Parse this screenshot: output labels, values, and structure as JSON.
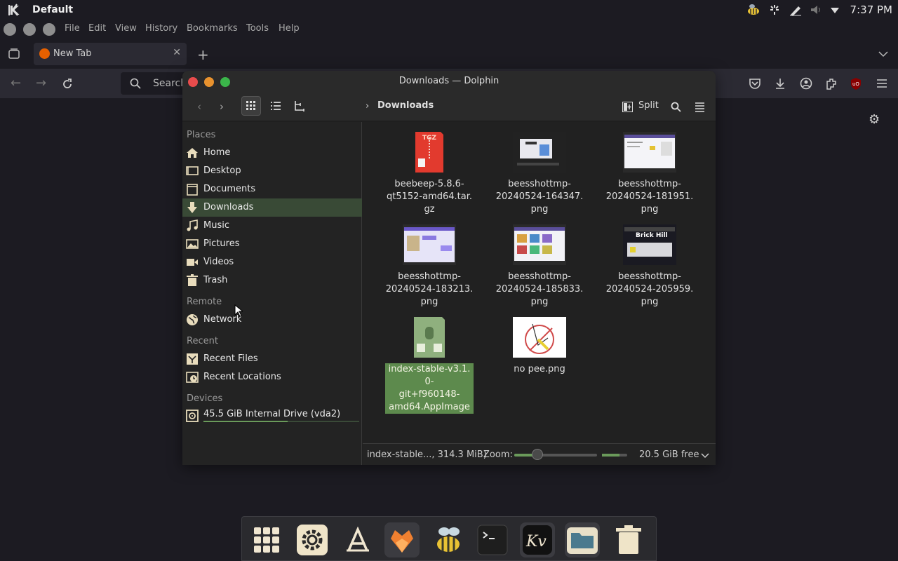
{
  "system": {
    "workspace_title": "Default",
    "clock": "7:37 PM"
  },
  "browser": {
    "menu": [
      "File",
      "Edit",
      "View",
      "History",
      "Bookmarks",
      "Tools",
      "Help"
    ],
    "tab": {
      "label": "New Tab"
    },
    "url_placeholder": "Search"
  },
  "dolphin": {
    "window_title": "Downloads — Dolphin",
    "breadcrumb": "Downloads",
    "split_label": "Split",
    "sidebar": {
      "places_header": "Places",
      "places": [
        {
          "label": "Home",
          "icon": "home-icon"
        },
        {
          "label": "Desktop",
          "icon": "desktop-icon"
        },
        {
          "label": "Documents",
          "icon": "documents-icon"
        },
        {
          "label": "Downloads",
          "icon": "downloads-icon",
          "selected": true
        },
        {
          "label": "Music",
          "icon": "music-icon"
        },
        {
          "label": "Pictures",
          "icon": "pictures-icon"
        },
        {
          "label": "Videos",
          "icon": "videos-icon"
        },
        {
          "label": "Trash",
          "icon": "trash-icon"
        }
      ],
      "remote_header": "Remote",
      "remote": [
        {
          "label": "Network",
          "icon": "network-icon"
        }
      ],
      "recent_header": "Recent",
      "recent": [
        {
          "label": "Recent Files",
          "icon": "recent-files-icon"
        },
        {
          "label": "Recent Locations",
          "icon": "recent-locations-icon"
        }
      ],
      "devices_header": "Devices",
      "devices": [
        {
          "label": "45.5 GiB Internal Drive (vda2)",
          "icon": "drive-icon",
          "usage_fraction": 0.54
        }
      ]
    },
    "files": [
      {
        "name": "beebeep-5.8.6-qt5152-amd64.tar.gz",
        "lines": [
          "beebeep-5.8.6-",
          "qt5152-amd64.tar.",
          "gz"
        ],
        "kind": "archive",
        "badge": "TGZ"
      },
      {
        "name": "beesshottmp-20240524-164347.png",
        "lines": [
          "beesshottmp-",
          "20240524-164347.",
          "png"
        ],
        "kind": "screenshot"
      },
      {
        "name": "beesshottmp-20240524-181951.png",
        "lines": [
          "beesshottmp-",
          "20240524-181951.",
          "png"
        ],
        "kind": "screenshot"
      },
      {
        "name": "beesshottmp-20240524-183213.png",
        "lines": [
          "beesshottmp-",
          "20240524-183213.",
          "png"
        ],
        "kind": "screenshot"
      },
      {
        "name": "beesshottmp-20240524-185833.png",
        "lines": [
          "beesshottmp-",
          "20240524-185833.",
          "png"
        ],
        "kind": "screenshot"
      },
      {
        "name": "beesshottmp-20240524-205959.png",
        "lines": [
          "beesshottmp-",
          "20240524-205959.",
          "png"
        ],
        "kind": "screenshot",
        "overlay_text": "Brick Hill"
      },
      {
        "name": "index-stable-v3.1.0-git+f960148-amd64.AppImage",
        "lines": [
          "index-stable-v3.1.0-",
          "git+f960148-",
          "amd64.AppImage"
        ],
        "kind": "appimage",
        "selected": true
      },
      {
        "name": "no pee.png",
        "lines": [
          "no pee.png"
        ],
        "kind": "drawing"
      }
    ],
    "status": {
      "selection": "index-stable..., 314.3 MiB)",
      "zoom_label": "Zoom:",
      "free": "20.5 GiB free"
    }
  },
  "dock": {
    "items": [
      {
        "icon": "app-grid-icon"
      },
      {
        "icon": "settings-icon"
      },
      {
        "icon": "font-icon"
      },
      {
        "icon": "firefox-icon",
        "running": true
      },
      {
        "icon": "bee-icon"
      },
      {
        "icon": "terminal-icon"
      },
      {
        "icon": "kvantum-icon",
        "running": true
      },
      {
        "icon": "files-icon",
        "running": true
      },
      {
        "icon": "trash-icon"
      }
    ]
  },
  "colors": {
    "accent_green": "#5d8a4d",
    "sidebar_selected": "#394a36",
    "archive_red": "#e23a2e"
  }
}
